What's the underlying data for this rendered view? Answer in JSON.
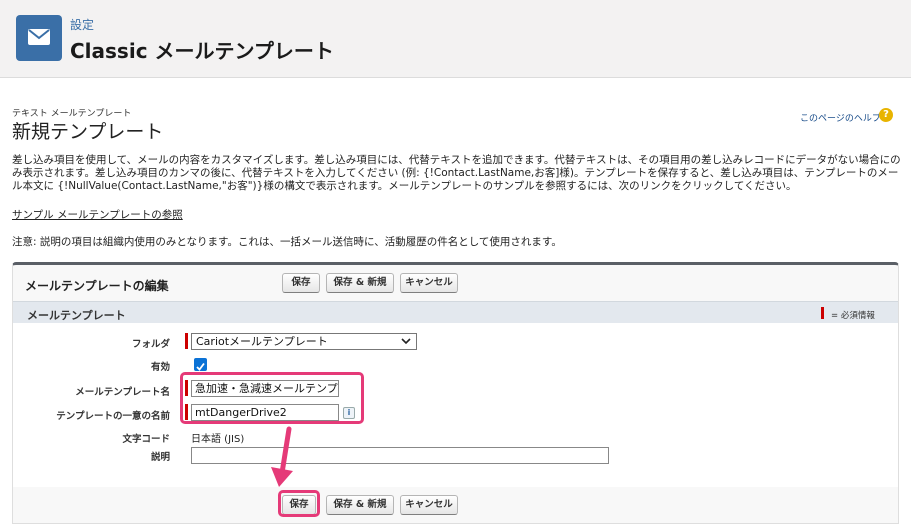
{
  "header": {
    "parent": "設定",
    "title": "Classic メールテンプレート",
    "icon": "envelope-icon"
  },
  "page": {
    "type_label": "テキスト メールテンプレート",
    "title": "新規テンプレート",
    "help_link": "このページのヘルプ",
    "help_icon": "?",
    "description": "差し込み項目を使用して、メールの内容をカスタマイズします。差し込み項目には、代替テキストを追加できます。代替テキストは、その項目用の差し込みレコードにデータがない場合にのみ表示されます。差し込み項目のカンマの後に、代替テキストを入力してください (例: {!Contact.LastName,お客]様)。テンプレートを保存すると、差し込み項目は、テンプレートのメール本文に {!NullValue(Contact.LastName,\"お客\")}様の構文で表示されます。メールテンプレートのサンプルを参照するには、次のリンクをクリックしてください。",
    "sample_link": "サンプル メールテンプレートの参照",
    "note": "注意: 説明の項目は組織内使用のみとなります。これは、一括メール送信時に、活動履歴の件名として使用されます。"
  },
  "panel": {
    "title": "メールテンプレートの編集",
    "buttons": {
      "save": "保存",
      "save_new": "保存 & 新規",
      "cancel": "キャンセル"
    },
    "section_title": "メールテンプレート",
    "required_legend": "= 必須情報"
  },
  "form": {
    "folder_label": "フォルダ",
    "folder_value": "Cariotメールテンプレート",
    "active_label": "有効",
    "active_checked": true,
    "template_name_label": "メールテンプレート名",
    "template_name_value": "急加速・急減速メールテンプレート",
    "unique_name_label": "テンプレートの一意の名前",
    "unique_name_value": "mtDangerDrive2",
    "info_icon": "i",
    "encoding_label": "文字コード",
    "encoding_value": "日本語 (JIS)",
    "description_label": "説明",
    "description_value": ""
  },
  "colors": {
    "brand": "#3a6fa7",
    "highlight": "#e53a78",
    "required": "#cc0000",
    "checkbox": "#0b72d6"
  }
}
